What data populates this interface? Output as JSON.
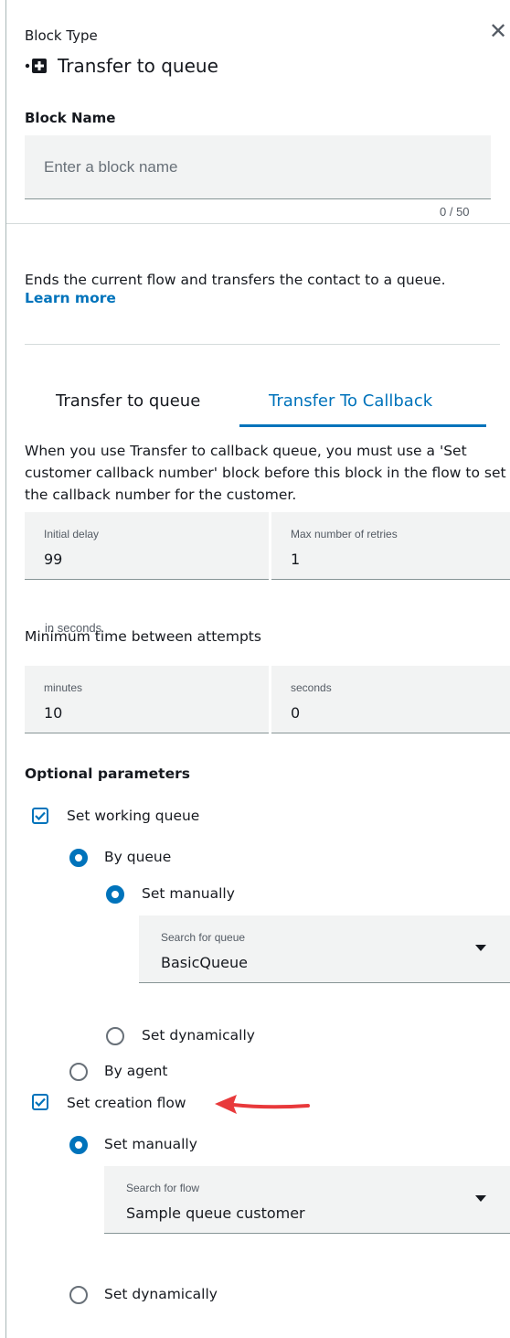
{
  "header": {
    "block_type_label": "Block Type",
    "title": "Transfer to queue",
    "close_label": "✕"
  },
  "block_name": {
    "label": "Block Name",
    "placeholder": "Enter a block name",
    "value": "",
    "counter": "0 / 50"
  },
  "description": {
    "text": "Ends the current flow and transfers the contact to a queue.",
    "learn_more": "Learn more"
  },
  "tabs": [
    {
      "label": "Transfer to queue",
      "active": false
    },
    {
      "label": "Transfer To Callback",
      "active": true
    }
  ],
  "callback_note": "When you use Transfer to callback queue, you must use a 'Set customer callback number' block before this block in the flow to set the callback number for the customer.",
  "initial_delay": {
    "label": "Initial delay",
    "value": "99",
    "hint": "in seconds"
  },
  "max_retries": {
    "label": "Max number of retries",
    "value": "1"
  },
  "min_time": {
    "label": "Minimum time between attempts",
    "minutes": {
      "label": "minutes",
      "value": "10"
    },
    "seconds": {
      "label": "seconds",
      "value": "0"
    }
  },
  "optional": {
    "heading": "Optional parameters",
    "working_queue": {
      "label": "Set working queue",
      "checked": true,
      "by_queue": "By queue",
      "set_manually": "Set manually",
      "search_label": "Search for queue",
      "search_value": "BasicQueue",
      "set_dynamically": "Set dynamically",
      "by_agent": "By agent"
    },
    "creation_flow": {
      "label": "Set creation flow",
      "checked": true,
      "set_manually": "Set manually",
      "search_label": "Search for flow",
      "search_value": "Sample queue customer",
      "set_dynamically": "Set dynamically"
    }
  },
  "colors": {
    "accent": "#0073bb",
    "annotation_arrow": "#e8393b",
    "field_bg": "#f2f3f3"
  }
}
